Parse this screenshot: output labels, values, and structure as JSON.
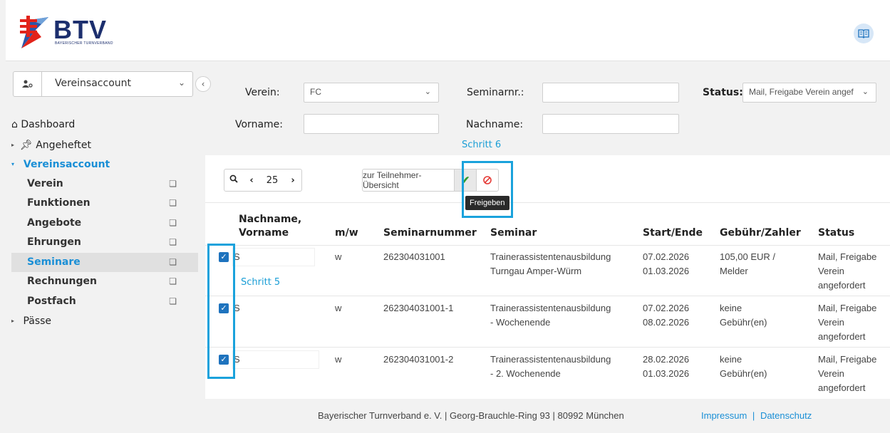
{
  "header": {
    "logo_text": "BTV",
    "logo_subtitle": "BAYERISCHER TURNVERBAND",
    "book_icon": "book-icon"
  },
  "sidebar": {
    "account_label": "Vereinsaccount",
    "nav": {
      "dashboard": "Dashboard",
      "angeheftet": "Angeheftet",
      "vereinsaccount": "Vereinsaccount",
      "items": [
        "Verein",
        "Funktionen",
        "Angebote",
        "Ehrungen",
        "Seminare",
        "Rechnungen",
        "Postfach"
      ],
      "paesse": "Pässe"
    }
  },
  "filters": {
    "verein_label": "Verein:",
    "verein_value": "FC",
    "seminarnr_label": "Seminarnr.:",
    "seminarnr_value": "",
    "status_label": "Status:",
    "status_value": "Mail, Freigabe Verein angef",
    "vorname_label": "Vorname:",
    "vorname_value": "",
    "nachname_label": "Nachname:",
    "nachname_value": ""
  },
  "annotations": {
    "step6": "Schritt 6",
    "step5": "Schritt 5"
  },
  "toolbar": {
    "page_size": "25",
    "participants_btn": "zur Teilnehmer-Übersicht",
    "tooltip": "Freigeben"
  },
  "table": {
    "headers": {
      "name_line1": "Nachname,",
      "name_line2": "Vorname",
      "mw": "m/w",
      "seminarnummer": "Seminarnummer",
      "seminar": "Seminar",
      "startende": "Start/Ende",
      "gebuehr": "Gebühr/Zahler",
      "status": "Status"
    },
    "rows": [
      {
        "name": "S",
        "mw": "w",
        "nummer": "262304031001",
        "seminar1": "Trainerassistentenausbildung",
        "seminar2": "Turngau Amper-Würm",
        "start": "07.02.2026",
        "ende": "01.03.2026",
        "gebuehr1": "105,00 EUR /",
        "gebuehr2": "Melder",
        "status1": "Mail, Freigabe",
        "status2": "Verein",
        "status3": "angefordert"
      },
      {
        "name": "S",
        "mw": "w",
        "nummer": "262304031001-1",
        "seminar1": "Trainerassistentenausbildung",
        "seminar2": "- Wochenende",
        "start": "07.02.2026",
        "ende": "08.02.2026",
        "gebuehr1": "keine",
        "gebuehr2": "Gebühr(en)",
        "status1": "Mail, Freigabe",
        "status2": "Verein",
        "status3": "angefordert"
      },
      {
        "name": "S",
        "mw": "w",
        "nummer": "262304031001-2",
        "seminar1": "Trainerassistentenausbildung",
        "seminar2": "- 2. Wochenende",
        "start": "28.02.2026",
        "ende": "01.03.2026",
        "gebuehr1": "keine",
        "gebuehr2": "Gebühr(en)",
        "status1": "Mail, Freigabe",
        "status2": "Verein",
        "status3": "angefordert"
      }
    ]
  },
  "footer": {
    "address": "Bayerischer Turnverband e. V.  |  Georg-Brauchle-Ring 93  |  80992 München",
    "impressum": "Impressum",
    "sep": "|",
    "datenschutz": "Datenschutz"
  },
  "colors": {
    "accent": "#1a8fd6",
    "highlight": "#1aa2dc",
    "brand": "#1c2f6e",
    "logo_red": "#e2231a"
  }
}
